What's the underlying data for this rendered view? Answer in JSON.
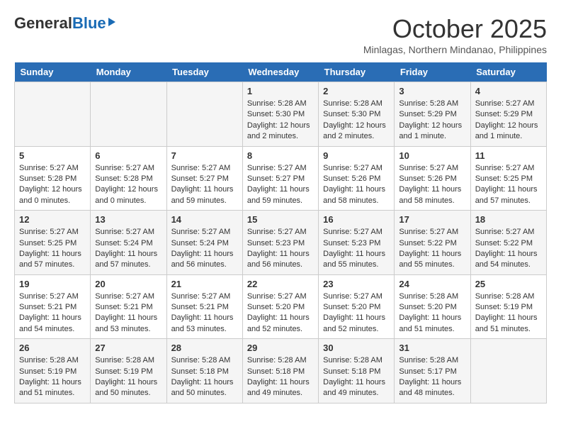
{
  "header": {
    "logo_general": "General",
    "logo_blue": "Blue",
    "month": "October 2025",
    "location": "Minlagas, Northern Mindanao, Philippines"
  },
  "days_of_week": [
    "Sunday",
    "Monday",
    "Tuesday",
    "Wednesday",
    "Thursday",
    "Friday",
    "Saturday"
  ],
  "weeks": [
    [
      {
        "day": "",
        "sunrise": "",
        "sunset": "",
        "daylight": ""
      },
      {
        "day": "",
        "sunrise": "",
        "sunset": "",
        "daylight": ""
      },
      {
        "day": "",
        "sunrise": "",
        "sunset": "",
        "daylight": ""
      },
      {
        "day": "1",
        "sunrise": "Sunrise: 5:28 AM",
        "sunset": "Sunset: 5:30 PM",
        "daylight": "Daylight: 12 hours and 2 minutes."
      },
      {
        "day": "2",
        "sunrise": "Sunrise: 5:28 AM",
        "sunset": "Sunset: 5:30 PM",
        "daylight": "Daylight: 12 hours and 2 minutes."
      },
      {
        "day": "3",
        "sunrise": "Sunrise: 5:28 AM",
        "sunset": "Sunset: 5:29 PM",
        "daylight": "Daylight: 12 hours and 1 minute."
      },
      {
        "day": "4",
        "sunrise": "Sunrise: 5:27 AM",
        "sunset": "Sunset: 5:29 PM",
        "daylight": "Daylight: 12 hours and 1 minute."
      }
    ],
    [
      {
        "day": "5",
        "sunrise": "Sunrise: 5:27 AM",
        "sunset": "Sunset: 5:28 PM",
        "daylight": "Daylight: 12 hours and 0 minutes."
      },
      {
        "day": "6",
        "sunrise": "Sunrise: 5:27 AM",
        "sunset": "Sunset: 5:28 PM",
        "daylight": "Daylight: 12 hours and 0 minutes."
      },
      {
        "day": "7",
        "sunrise": "Sunrise: 5:27 AM",
        "sunset": "Sunset: 5:27 PM",
        "daylight": "Daylight: 11 hours and 59 minutes."
      },
      {
        "day": "8",
        "sunrise": "Sunrise: 5:27 AM",
        "sunset": "Sunset: 5:27 PM",
        "daylight": "Daylight: 11 hours and 59 minutes."
      },
      {
        "day": "9",
        "sunrise": "Sunrise: 5:27 AM",
        "sunset": "Sunset: 5:26 PM",
        "daylight": "Daylight: 11 hours and 58 minutes."
      },
      {
        "day": "10",
        "sunrise": "Sunrise: 5:27 AM",
        "sunset": "Sunset: 5:26 PM",
        "daylight": "Daylight: 11 hours and 58 minutes."
      },
      {
        "day": "11",
        "sunrise": "Sunrise: 5:27 AM",
        "sunset": "Sunset: 5:25 PM",
        "daylight": "Daylight: 11 hours and 57 minutes."
      }
    ],
    [
      {
        "day": "12",
        "sunrise": "Sunrise: 5:27 AM",
        "sunset": "Sunset: 5:25 PM",
        "daylight": "Daylight: 11 hours and 57 minutes."
      },
      {
        "day": "13",
        "sunrise": "Sunrise: 5:27 AM",
        "sunset": "Sunset: 5:24 PM",
        "daylight": "Daylight: 11 hours and 57 minutes."
      },
      {
        "day": "14",
        "sunrise": "Sunrise: 5:27 AM",
        "sunset": "Sunset: 5:24 PM",
        "daylight": "Daylight: 11 hours and 56 minutes."
      },
      {
        "day": "15",
        "sunrise": "Sunrise: 5:27 AM",
        "sunset": "Sunset: 5:23 PM",
        "daylight": "Daylight: 11 hours and 56 minutes."
      },
      {
        "day": "16",
        "sunrise": "Sunrise: 5:27 AM",
        "sunset": "Sunset: 5:23 PM",
        "daylight": "Daylight: 11 hours and 55 minutes."
      },
      {
        "day": "17",
        "sunrise": "Sunrise: 5:27 AM",
        "sunset": "Sunset: 5:22 PM",
        "daylight": "Daylight: 11 hours and 55 minutes."
      },
      {
        "day": "18",
        "sunrise": "Sunrise: 5:27 AM",
        "sunset": "Sunset: 5:22 PM",
        "daylight": "Daylight: 11 hours and 54 minutes."
      }
    ],
    [
      {
        "day": "19",
        "sunrise": "Sunrise: 5:27 AM",
        "sunset": "Sunset: 5:21 PM",
        "daylight": "Daylight: 11 hours and 54 minutes."
      },
      {
        "day": "20",
        "sunrise": "Sunrise: 5:27 AM",
        "sunset": "Sunset: 5:21 PM",
        "daylight": "Daylight: 11 hours and 53 minutes."
      },
      {
        "day": "21",
        "sunrise": "Sunrise: 5:27 AM",
        "sunset": "Sunset: 5:21 PM",
        "daylight": "Daylight: 11 hours and 53 minutes."
      },
      {
        "day": "22",
        "sunrise": "Sunrise: 5:27 AM",
        "sunset": "Sunset: 5:20 PM",
        "daylight": "Daylight: 11 hours and 52 minutes."
      },
      {
        "day": "23",
        "sunrise": "Sunrise: 5:27 AM",
        "sunset": "Sunset: 5:20 PM",
        "daylight": "Daylight: 11 hours and 52 minutes."
      },
      {
        "day": "24",
        "sunrise": "Sunrise: 5:28 AM",
        "sunset": "Sunset: 5:20 PM",
        "daylight": "Daylight: 11 hours and 51 minutes."
      },
      {
        "day": "25",
        "sunrise": "Sunrise: 5:28 AM",
        "sunset": "Sunset: 5:19 PM",
        "daylight": "Daylight: 11 hours and 51 minutes."
      }
    ],
    [
      {
        "day": "26",
        "sunrise": "Sunrise: 5:28 AM",
        "sunset": "Sunset: 5:19 PM",
        "daylight": "Daylight: 11 hours and 51 minutes."
      },
      {
        "day": "27",
        "sunrise": "Sunrise: 5:28 AM",
        "sunset": "Sunset: 5:19 PM",
        "daylight": "Daylight: 11 hours and 50 minutes."
      },
      {
        "day": "28",
        "sunrise": "Sunrise: 5:28 AM",
        "sunset": "Sunset: 5:18 PM",
        "daylight": "Daylight: 11 hours and 50 minutes."
      },
      {
        "day": "29",
        "sunrise": "Sunrise: 5:28 AM",
        "sunset": "Sunset: 5:18 PM",
        "daylight": "Daylight: 11 hours and 49 minutes."
      },
      {
        "day": "30",
        "sunrise": "Sunrise: 5:28 AM",
        "sunset": "Sunset: 5:18 PM",
        "daylight": "Daylight: 11 hours and 49 minutes."
      },
      {
        "day": "31",
        "sunrise": "Sunrise: 5:28 AM",
        "sunset": "Sunset: 5:17 PM",
        "daylight": "Daylight: 11 hours and 48 minutes."
      },
      {
        "day": "",
        "sunrise": "",
        "sunset": "",
        "daylight": ""
      }
    ]
  ]
}
